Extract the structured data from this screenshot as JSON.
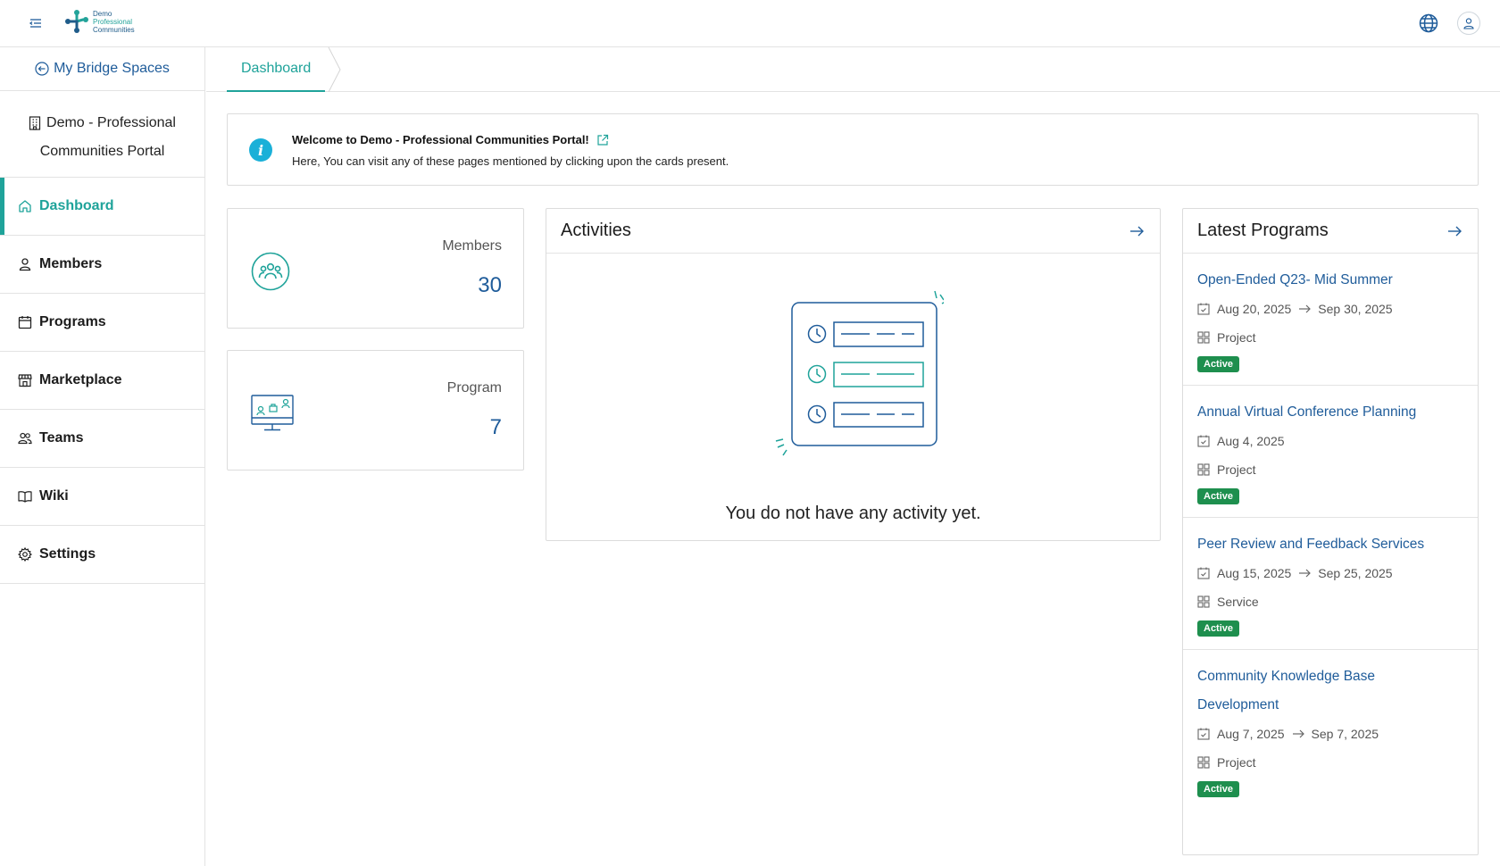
{
  "header": {
    "logo": {
      "line1": "Demo",
      "line2": "Professional",
      "line3": "Communities"
    },
    "icons": {
      "menu": "menu-toggle-icon",
      "globe": "globe-icon",
      "user": "user-icon"
    }
  },
  "sidebar": {
    "back_label": "My Bridge Spaces",
    "org": {
      "line1": "Demo - Professional",
      "line2": "Communities Portal"
    },
    "items": [
      {
        "label": "Dashboard",
        "icon": "home-icon"
      },
      {
        "label": "Members",
        "icon": "user-icon"
      },
      {
        "label": "Programs",
        "icon": "calendar-icon"
      },
      {
        "label": "Marketplace",
        "icon": "store-icon"
      },
      {
        "label": "Teams",
        "icon": "team-icon"
      },
      {
        "label": "Wiki",
        "icon": "book-icon"
      },
      {
        "label": "Settings",
        "icon": "gear-icon"
      }
    ]
  },
  "tabs": {
    "active": "Dashboard"
  },
  "welcome": {
    "title": "Welcome to Demo - Professional Communities Portal!",
    "description": "Here, You can visit any of these pages mentioned by clicking upon the cards present."
  },
  "stats": {
    "members": {
      "label": "Members",
      "value": "30"
    },
    "program": {
      "label": "Program",
      "value": "7"
    }
  },
  "activities": {
    "title": "Activities",
    "empty": "You do not have any activity yet."
  },
  "latest_programs": {
    "title": "Latest Programs",
    "items": [
      {
        "title": "Open-Ended Q23- Mid Summer",
        "start": "Aug 20, 2025",
        "end": "Sep 30, 2025",
        "type": "Project",
        "status": "Active"
      },
      {
        "title": "Annual Virtual Conference Planning",
        "start": "Aug 4, 2025",
        "end": "",
        "type": "Project",
        "status": "Active"
      },
      {
        "title": "Peer Review and Feedback Services",
        "start": "Aug 15, 2025",
        "end": "Sep 25, 2025",
        "type": "Service",
        "status": "Active"
      },
      {
        "title": "Community Knowledge Base Development",
        "start": "Aug 7, 2025",
        "end": "Sep 7, 2025",
        "type": "Project",
        "status": "Active"
      }
    ]
  },
  "colors": {
    "accent": "#1fa39a",
    "link": "#1f5c9a",
    "badge": "#1e8f4e",
    "info": "#1ab0d8"
  }
}
